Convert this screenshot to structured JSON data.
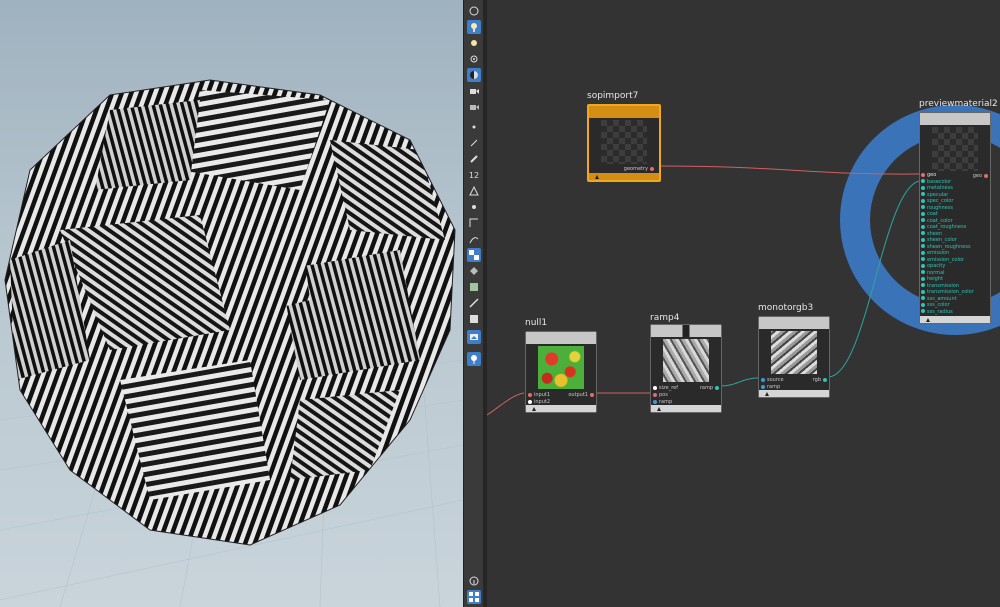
{
  "viewport": {
    "description_free": true
  },
  "toolbar": {
    "icons": [
      "display-options-icon",
      "light-icon",
      "light-sun-icon",
      "light-spot-icon",
      "shading-icon",
      "camera-icon",
      "camera-2-icon",
      "point-icon",
      "pick-icon",
      "paint-icon",
      "ik-icon",
      "uv-icon",
      "bone-icon",
      "bend-icon",
      "checker-icon",
      "cube-icon",
      "texture-icon",
      "brush-icon",
      "box-icon",
      "image-icon",
      "pin-icon",
      "info-icon",
      "grid-icon"
    ],
    "badge_number": "12"
  },
  "nodes": {
    "sopimport": {
      "name": "sopimport7",
      "outputs": [
        "geometry"
      ]
    },
    "previewmaterial": {
      "name": "previewmaterial2",
      "output": "geo",
      "inputs": [
        "geo",
        "basecolor",
        "metalness",
        "specular",
        "spec_color",
        "roughness",
        "coat",
        "coat_color",
        "coat_roughness",
        "sheen",
        "sheen_color",
        "sheen_roughness",
        "emission",
        "emission_color",
        "opacity",
        "normal",
        "height",
        "transmission",
        "transmission_color",
        "sss_amount",
        "sss_color",
        "sss_radius"
      ]
    },
    "null": {
      "name": "null1",
      "inputs": [
        "input1",
        "input2"
      ],
      "output": "output1"
    },
    "ramp": {
      "name": "ramp4",
      "inputs": [
        "size_ref",
        "pos",
        "ramp"
      ],
      "output": "ramp"
    },
    "monotorgb": {
      "name": "monotorgb3",
      "inputs": [
        "source",
        "ramp"
      ],
      "output": "rgb"
    }
  },
  "colors": {
    "accent_blue": "#3a73b8",
    "selected_orange": "#f0a81c",
    "wire_red": "#d06060",
    "wire_teal": "#2aa7a0",
    "port_teal": "#2ec4b6",
    "port_red": "#e86a6a"
  }
}
